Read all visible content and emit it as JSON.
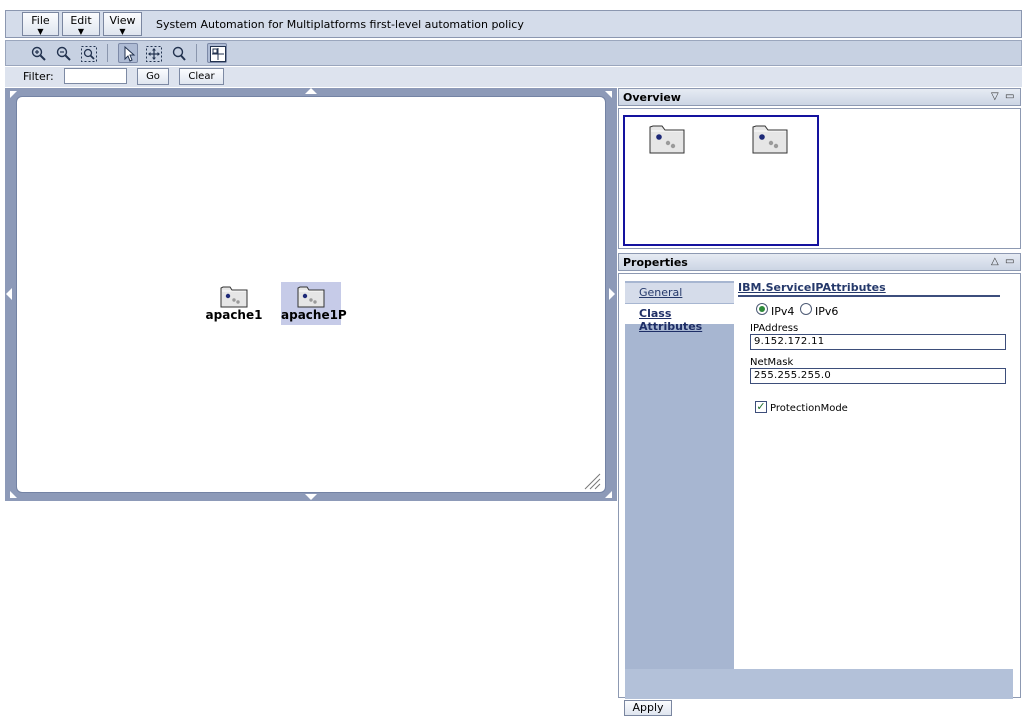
{
  "menu": {
    "file_label": "File",
    "edit_label": "Edit",
    "view_label": "View",
    "title": "System Automation for Multiplatforms first-level automation policy"
  },
  "toolbar": {
    "icons": [
      "zoom-in-icon",
      "zoom-out-icon",
      "zoom-fit-icon",
      "select-pointer-icon",
      "pan-icon",
      "marquee-zoom-icon",
      "overview-toggle-icon"
    ]
  },
  "filter": {
    "label": "Filter:",
    "value": "",
    "go_label": "Go",
    "clear_label": "Clear"
  },
  "canvas": {
    "nodes": [
      {
        "label": "apache1"
      },
      {
        "label": "apache1P"
      }
    ]
  },
  "overview": {
    "title": "Overview"
  },
  "properties": {
    "title": "Properties",
    "tabs": [
      "General",
      "Class Attributes"
    ],
    "section_title": "IBM.ServiceIPAttributes",
    "ip_versions": [
      "IPv4",
      "IPv6"
    ],
    "ip_version_selected": "IPv4",
    "ip_address_label": "IPAddress",
    "ip_address_value": "9.152.172.11",
    "netmask_label": "NetMask",
    "netmask_value": "255.255.255.0",
    "protection_mode_label": "ProtectionMode",
    "protection_mode_checked": true,
    "apply_label": "Apply"
  },
  "colors": {
    "panel_blue": "#a7b6d1",
    "canvas_frame": "#8d9ab8",
    "selection": "#c6cbe8",
    "viewport_border": "#14129e"
  }
}
